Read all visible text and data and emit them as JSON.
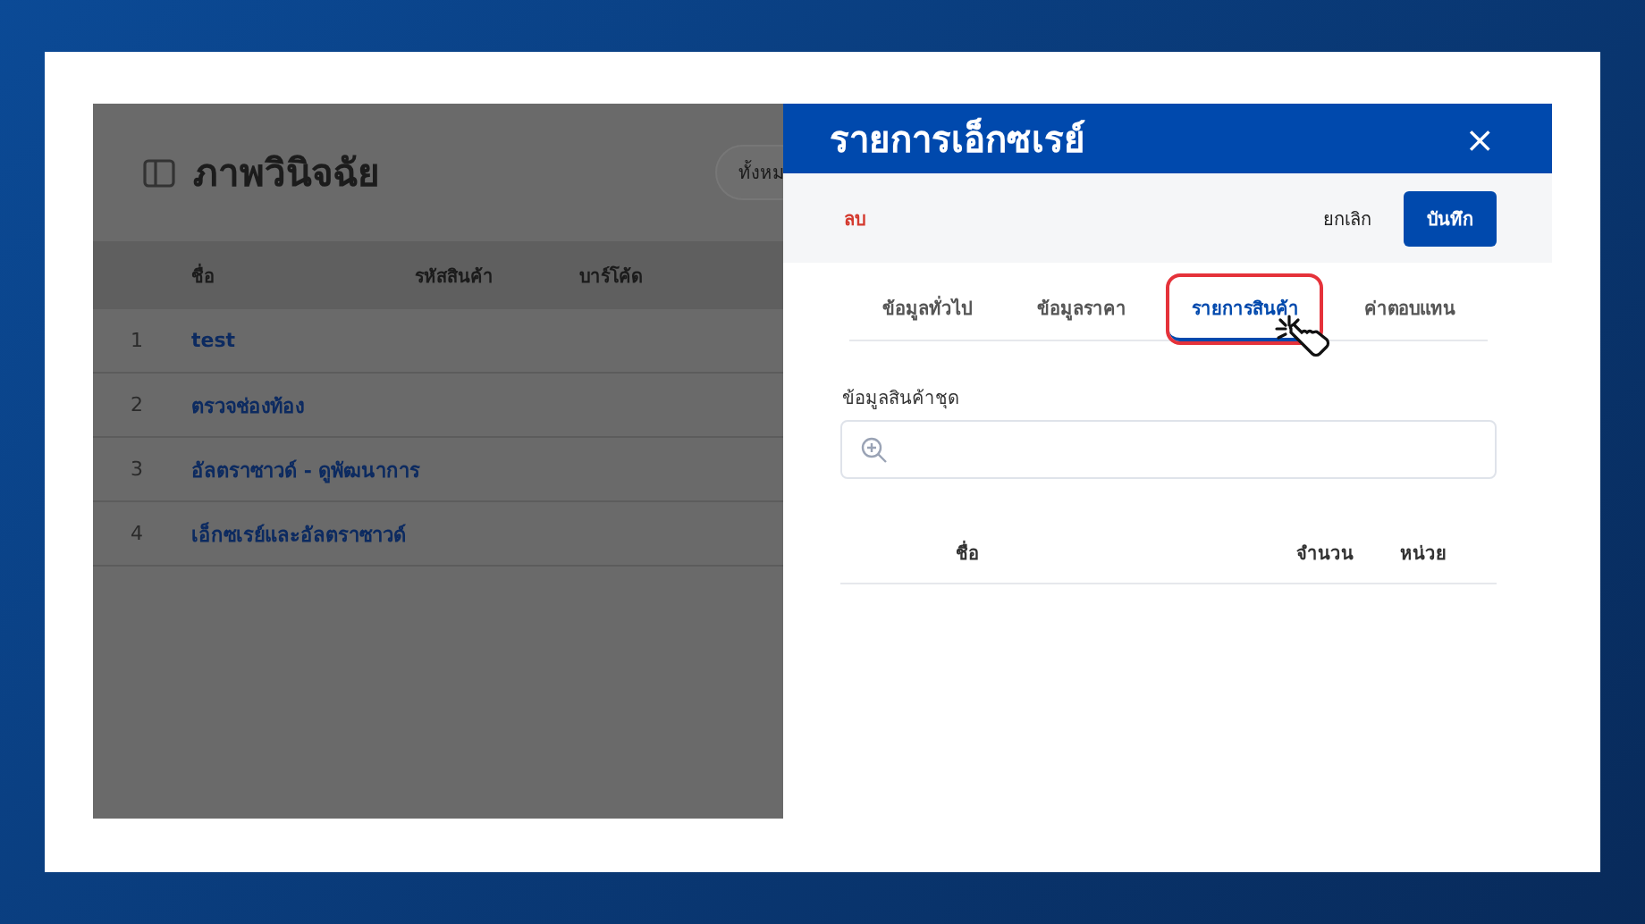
{
  "page": {
    "title": "ภาพวินิจฉัย",
    "filter": "ทั้งหม",
    "table": {
      "columns": [
        "ชื่อ",
        "รหัสสินค้า",
        "บาร์โค้ด"
      ],
      "rows": [
        {
          "index": "1",
          "name": "test"
        },
        {
          "index": "2",
          "name": "ตรวจช่องท้อง"
        },
        {
          "index": "3",
          "name": "อัลตราซาวด์ - ดูพัฒนาการ"
        },
        {
          "index": "4",
          "name": "เอ็กซเรย์และอัลตราซาวด์"
        }
      ]
    }
  },
  "panel": {
    "title": "รายการเอ็กซเรย์",
    "close": "×",
    "delete": "ลบ",
    "cancel": "ยกเลิก",
    "save": "บันทึก",
    "tabs": [
      {
        "label": "ข้อมูลทั่วไป",
        "selected": false
      },
      {
        "label": "ข้อมูลราคา",
        "selected": false
      },
      {
        "label": "รายการสินค้า",
        "selected": true
      },
      {
        "label": "ค่าตอบแทน",
        "selected": false
      }
    ],
    "field": {
      "label": "ข้อมูลสินค้าชุด"
    },
    "table": {
      "columns": [
        "ชื่อ",
        "จำนวน",
        "หน่วย"
      ]
    }
  }
}
